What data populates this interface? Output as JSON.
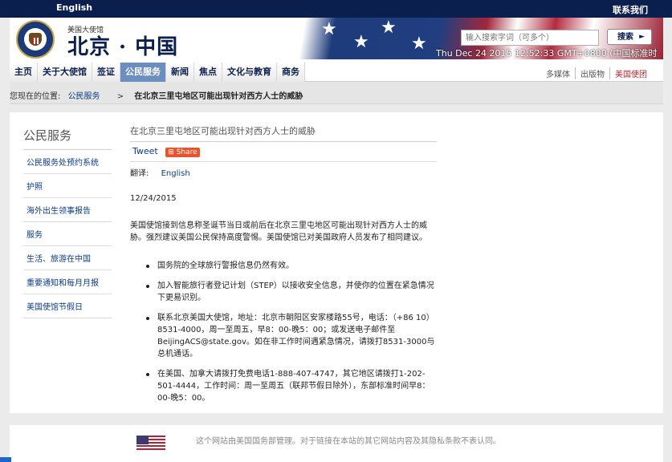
{
  "topbar": {
    "language_link": "English",
    "contact_link": "联系我们"
  },
  "banner": {
    "embassy_small": "美国大使馆",
    "embassy_big": "北京 · 中国",
    "search_placeholder": "输入搜索字词（可多个）",
    "search_button": "搜索",
    "datetime": "Thu Dec 24 2015 12:52:33 GMT+0800 (中国标准时间)"
  },
  "nav": {
    "items": [
      "主页",
      "关于大使馆",
      "签证",
      "公民服务",
      "新闻",
      "焦点",
      "文化与教育",
      "商务"
    ],
    "active": "公民服务",
    "right_links": [
      "多媒体",
      "出版物",
      "美国使团"
    ]
  },
  "breadcrumb": {
    "label": "您现在的位置:",
    "section": "公民服务",
    "separator": ">",
    "current": "在北京三里屯地区可能出现针对西方人士的威胁"
  },
  "sidebar": {
    "title": "公民服务",
    "items": [
      "公民服务处预约系统",
      "护照",
      "海外出生领事报告",
      "服务",
      "生活、旅游在中国",
      "重要通知和每月月报",
      "美国使馆节假日"
    ]
  },
  "article": {
    "title": "在北京三里屯地区可能出现针对西方人士的威胁",
    "tweet": "Tweet",
    "share": "Share",
    "translate_label": "翻译:",
    "translate_link": "English",
    "date": "12/24/2015",
    "paragraph": "美国使馆接到信息称圣诞节当日或前后在北京三里屯地区可能出现针对西方人士的威胁。强烈建议美国公民保持高度警惕。美国使馆已对美国政府人员发布了相同建议。",
    "bullets": [
      "国务院的全球旅行警报信息仍然有效。",
      "加入智能旅行者登记计划（STEP）以接收安全信息，并使你的位置在紧急情况下更易识别。",
      "联系北京美国大使馆，地址：北京市朝阳区安家楼路55号，电话：（+86 10）8531-4000，周一至周五，早8：00-晚5：00；或发送电子邮件至BeijingACS@state.gov。如在非工作时间遇紧急情况，请拨打8531-3000与总机通话。",
      "在美国、加拿大请拨打免费电话1-888-407-4747，其它地区请拨打1-202-501-4444，工作时间：周一至周五（联邦节假日除外），东部标准时间早8：00-晚5：00。"
    ]
  },
  "footer": {
    "text": "这个网站由美国国务部管理。对于链接在本站的其它网站内容及其隐私条款不表认同。"
  }
}
